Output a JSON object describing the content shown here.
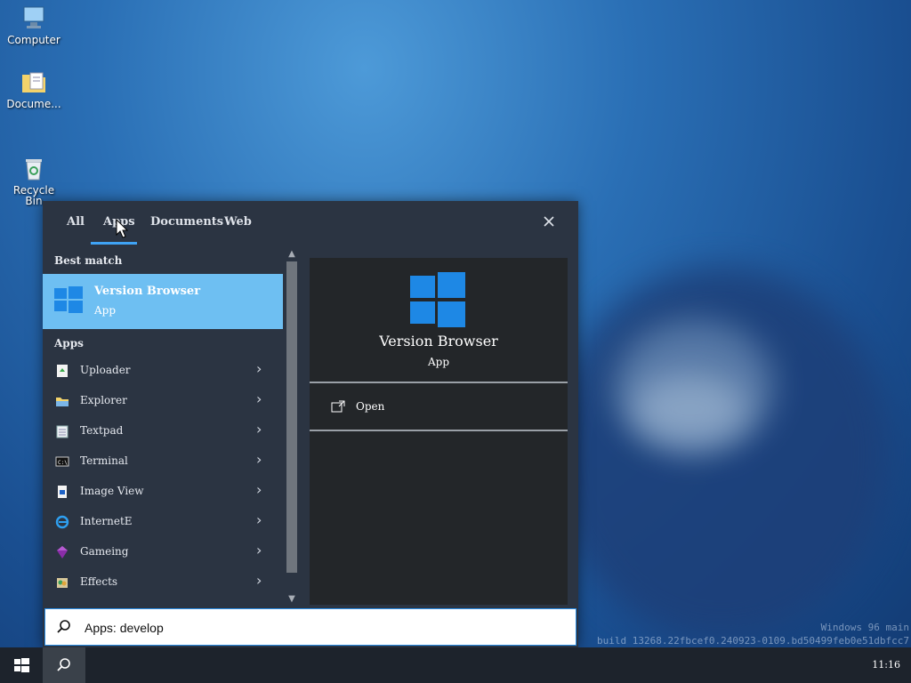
{
  "desktop": {
    "icons": [
      {
        "label": "Computer"
      },
      {
        "label": "Docume..."
      },
      {
        "label": "Recycle\nBin"
      }
    ],
    "watermark": {
      "line1": "Windows 96 main",
      "line2": "build 13268.22fbcef0.240923-0109.bd50499feb0e51dbfcc7"
    }
  },
  "search_flyout": {
    "tabs": [
      "All",
      "Apps",
      "Documents",
      "Web"
    ],
    "active_tab": "Apps",
    "close_icon": "close-icon",
    "best_match_title": "Best match",
    "best_match": {
      "name": "Version Browser",
      "kind": "App"
    },
    "apps_title": "Apps",
    "apps": [
      {
        "label": "Uploader",
        "icon": "uploader-icon"
      },
      {
        "label": "Explorer",
        "icon": "folder-icon"
      },
      {
        "label": "Textpad",
        "icon": "notepad-icon"
      },
      {
        "label": "Terminal",
        "icon": "terminal-icon"
      },
      {
        "label": "Image View",
        "icon": "image-icon"
      },
      {
        "label": "InternetE",
        "icon": "browser-e-icon"
      },
      {
        "label": "Gameing",
        "icon": "gem-icon"
      },
      {
        "label": "Effects",
        "icon": "effects-icon"
      }
    ],
    "detail": {
      "name": "Version Browser",
      "kind": "App",
      "action": "Open"
    },
    "search_value": "Apps: develop"
  },
  "taskbar": {
    "clock": "11:16"
  },
  "colors": {
    "accent": "#3fa3f5",
    "best_match_bg": "#6ebff2",
    "win_blue": "#1e88e5"
  }
}
